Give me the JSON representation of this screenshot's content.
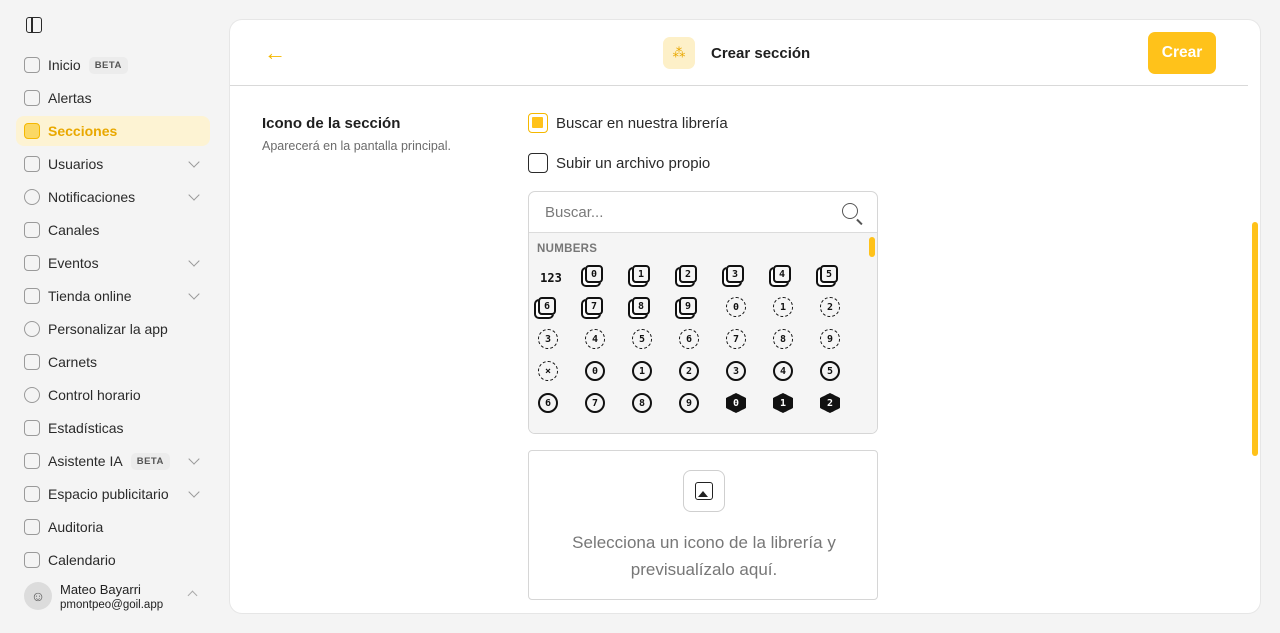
{
  "sidebar": {
    "items": [
      {
        "label": "Inicio",
        "badge": "BETA",
        "icon": "home-icon",
        "chevron": false
      },
      {
        "label": "Alertas",
        "icon": "alert-icon",
        "chevron": false
      },
      {
        "label": "Secciones",
        "icon": "sections-icon",
        "chevron": false,
        "active": true
      },
      {
        "label": "Usuarios",
        "icon": "users-icon",
        "chevron": true
      },
      {
        "label": "Notificaciones",
        "icon": "chat-icon",
        "chevron": true
      },
      {
        "label": "Canales",
        "icon": "channels-icon",
        "chevron": false
      },
      {
        "label": "Eventos",
        "icon": "ticket-icon",
        "chevron": true
      },
      {
        "label": "Tienda online",
        "icon": "cart-icon",
        "chevron": true
      },
      {
        "label": "Personalizar la app",
        "icon": "gear-icon",
        "chevron": false
      },
      {
        "label": "Carnets",
        "icon": "card-icon",
        "chevron": false
      },
      {
        "label": "Control horario",
        "icon": "clock-icon",
        "chevron": false
      },
      {
        "label": "Estadísticas",
        "icon": "chart-icon",
        "chevron": false
      },
      {
        "label": "Asistente IA",
        "badge": "BETA",
        "icon": "sparkle-icon",
        "chevron": true
      },
      {
        "label": "Espacio publicitario",
        "icon": "phone-icon",
        "chevron": true
      },
      {
        "label": "Auditoria",
        "icon": "audit-icon",
        "chevron": false
      },
      {
        "label": "Calendario",
        "icon": "calendar-icon",
        "chevron": false
      }
    ],
    "user": {
      "name": "Mateo Bayarri",
      "email": "pmontpeo@goil.app"
    }
  },
  "header": {
    "title": "Crear sección",
    "create_label": "Crear"
  },
  "section": {
    "title": "Icono de la sección",
    "description": "Aparecerá en la pantalla principal.",
    "option_library": "Buscar en nuestra librería",
    "option_upload": "Subir un archivo propio",
    "search_placeholder": "Buscar...",
    "category": "NUMBERS",
    "preview_text": "Selecciona un icono de la librería y previsualízalo aquí."
  },
  "icons": [
    {
      "t": "123",
      "s": "plain"
    },
    {
      "t": "0",
      "s": "sq"
    },
    {
      "t": "1",
      "s": "sq"
    },
    {
      "t": "2",
      "s": "sq"
    },
    {
      "t": "3",
      "s": "sq"
    },
    {
      "t": "4",
      "s": "sq"
    },
    {
      "t": "5",
      "s": "sq"
    },
    {
      "t": "6",
      "s": "sq"
    },
    {
      "t": "7",
      "s": "sq"
    },
    {
      "t": "8",
      "s": "sq"
    },
    {
      "t": "9",
      "s": "sq"
    },
    {
      "t": "0",
      "s": "dash"
    },
    {
      "t": "1",
      "s": "dash"
    },
    {
      "t": "2",
      "s": "dash"
    },
    {
      "t": "3",
      "s": "dash"
    },
    {
      "t": "4",
      "s": "dash"
    },
    {
      "t": "5",
      "s": "dash"
    },
    {
      "t": "6",
      "s": "dash"
    },
    {
      "t": "7",
      "s": "dash"
    },
    {
      "t": "8",
      "s": "dash"
    },
    {
      "t": "9",
      "s": "dash"
    },
    {
      "t": "×",
      "s": "dash"
    },
    {
      "t": "0",
      "s": "circ"
    },
    {
      "t": "1",
      "s": "circ"
    },
    {
      "t": "2",
      "s": "circ"
    },
    {
      "t": "3",
      "s": "circ"
    },
    {
      "t": "4",
      "s": "circ"
    },
    {
      "t": "5",
      "s": "circ"
    },
    {
      "t": "6",
      "s": "circ"
    },
    {
      "t": "7",
      "s": "circ"
    },
    {
      "t": "8",
      "s": "circ"
    },
    {
      "t": "9",
      "s": "circ"
    },
    {
      "t": "0",
      "s": "hex"
    },
    {
      "t": "1",
      "s": "hex"
    },
    {
      "t": "2",
      "s": "hex"
    }
  ],
  "colors": {
    "accent": "#ffc21a",
    "active_bg": "#fdf3d3"
  }
}
